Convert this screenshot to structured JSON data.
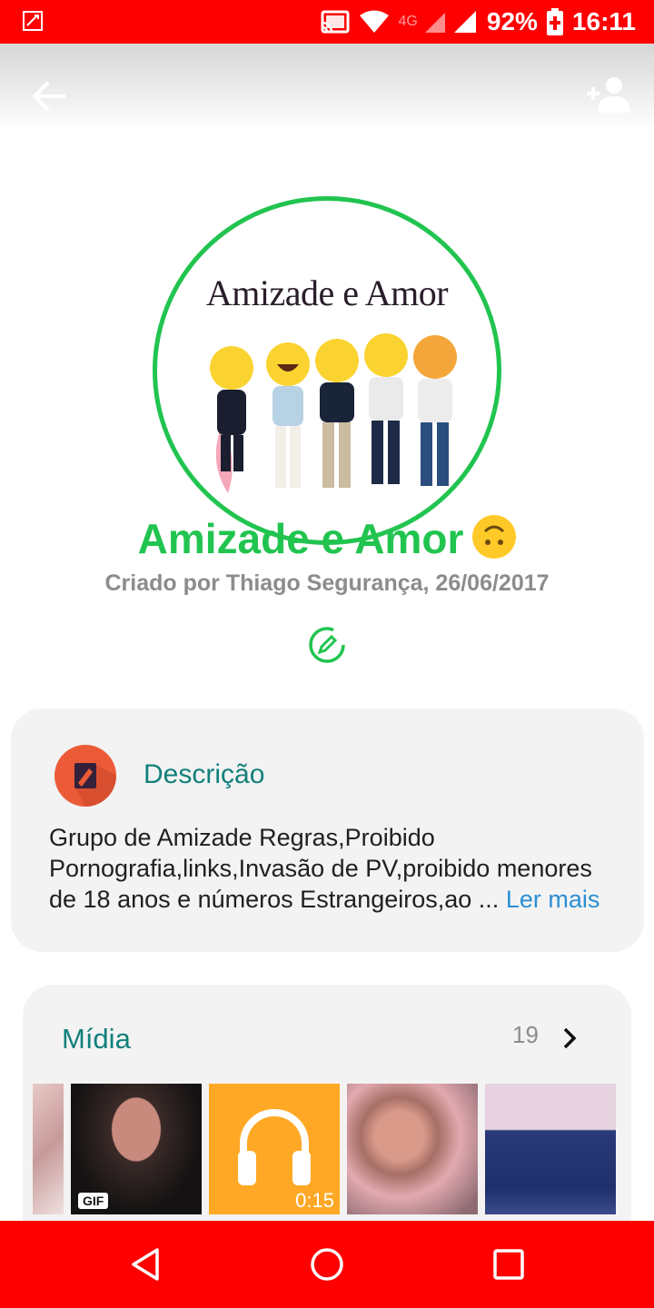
{
  "status_bar": {
    "network": "4G",
    "battery": "92%",
    "time": "16:11"
  },
  "header": {
    "back_icon": "arrow-left-icon",
    "add_participant_icon": "person-add-icon"
  },
  "avatar": {
    "image_text": "Amizade e Amor"
  },
  "group": {
    "name": "Amizade e Amor",
    "name_emoji": "upside-down-face-emoji",
    "created_by": "Criado por Thiago Segurança, 26/06/2017"
  },
  "description": {
    "title": "Descrição",
    "text": "Grupo de Amizade  Regras,Proibido Pornografia,links,Invasão de PV,proibido menores de 18 anos e números Estrangeiros,ao ...",
    "read_more": "Ler mais"
  },
  "media": {
    "title": "Mídia",
    "count": "19",
    "items": [
      {
        "type": "image"
      },
      {
        "type": "gif",
        "badge": "GIF"
      },
      {
        "type": "audio",
        "duration": "0:15"
      },
      {
        "type": "image"
      },
      {
        "type": "image"
      }
    ]
  },
  "colors": {
    "status_bar": "#ff0000",
    "accent_green": "#21c44f",
    "teal": "#12807b",
    "link_blue": "#2b8fd4"
  }
}
